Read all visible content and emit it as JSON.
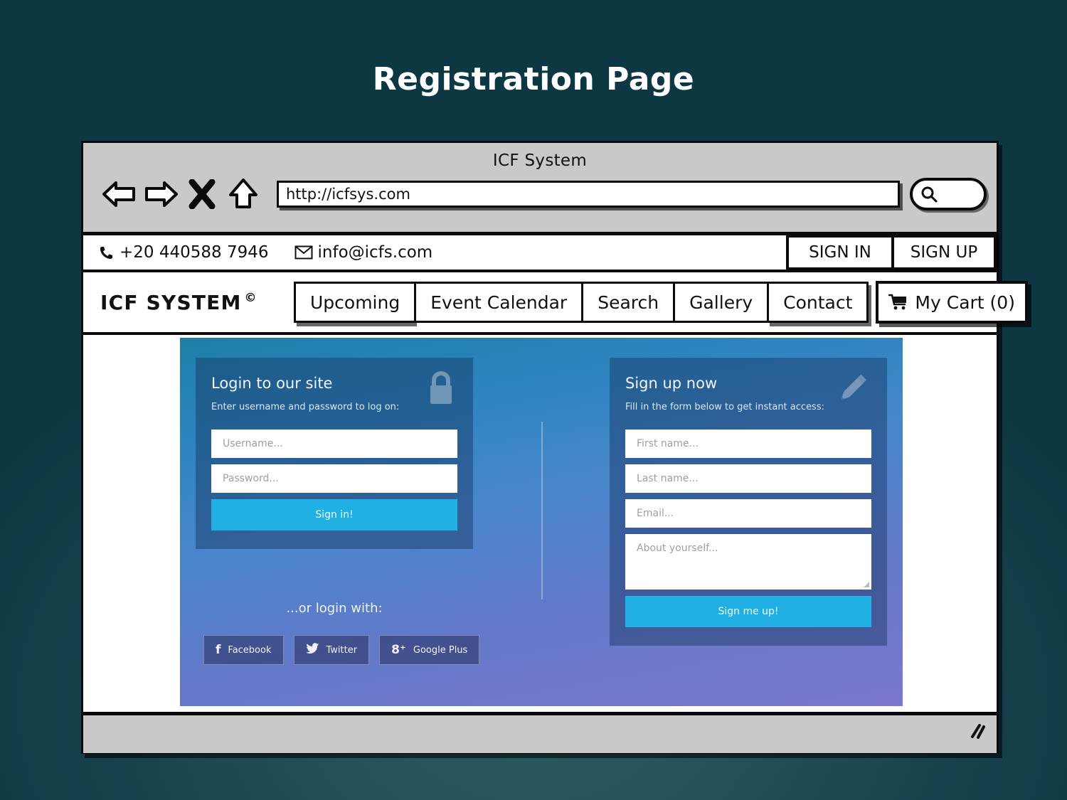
{
  "slide": {
    "title": "Registration Page"
  },
  "browser": {
    "window_title": "ICF System",
    "url": "http://icfsys.com",
    "toolbar_icons": [
      "back-arrow-icon",
      "forward-arrow-icon",
      "stop-x-icon",
      "home-icon"
    ],
    "search_icon": "search-icon",
    "status_bar_grip": "resize-grip-icon"
  },
  "contact_bar": {
    "phone_icon": "phone-icon",
    "phone": "+20 440588 7946",
    "email_icon": "envelope-icon",
    "email": "info@icfs.com",
    "sign_in_label": "SIGN IN",
    "sign_up_label": "SIGN UP"
  },
  "navbar": {
    "brand": "ICF SYSTEM",
    "brand_mark": "©",
    "items": [
      {
        "label": "Upcoming"
      },
      {
        "label": "Event Calendar"
      },
      {
        "label": "Search"
      },
      {
        "label": "Gallery"
      },
      {
        "label": "Contact"
      }
    ],
    "cart": {
      "icon": "shopping-cart-icon",
      "label": "My Cart (0)"
    }
  },
  "login_panel": {
    "icon": "lock-icon",
    "title": "Login to our site",
    "subtitle": "Enter username and password to log on:",
    "fields": [
      {
        "name": "username",
        "placeholder": "Username..."
      },
      {
        "name": "password",
        "placeholder": "Password..."
      }
    ],
    "submit_label": "Sign in!",
    "or_label": "...or login with:",
    "social": [
      {
        "glyph": "f",
        "label": "Facebook",
        "icon": "facebook-icon"
      },
      {
        "glyph": "ᴠ",
        "label": "Twitter",
        "icon": "twitter-icon"
      },
      {
        "glyph": "8⁺",
        "label": "Google Plus",
        "icon": "google-plus-icon"
      }
    ]
  },
  "signup_panel": {
    "icon": "pencil-icon",
    "title": "Sign up now",
    "subtitle": "Fill in the form below to get instant access:",
    "fields": [
      {
        "name": "first-name",
        "placeholder": "First name..."
      },
      {
        "name": "last-name",
        "placeholder": "Last name..."
      },
      {
        "name": "email",
        "placeholder": "Email..."
      }
    ],
    "textarea": {
      "name": "about-yourself",
      "placeholder": "About yourself..."
    },
    "submit_label": "Sign me up!"
  },
  "colors": {
    "accent_cyan": "#20b0e3",
    "hero_top": "#1d7fa8",
    "hero_bottom": "#7b78cd",
    "page_bg_center": "#2c5b61",
    "page_bg_edge": "#0e3744",
    "chrome_grey": "#c9c9c9",
    "ink": "#0a0a0a"
  }
}
